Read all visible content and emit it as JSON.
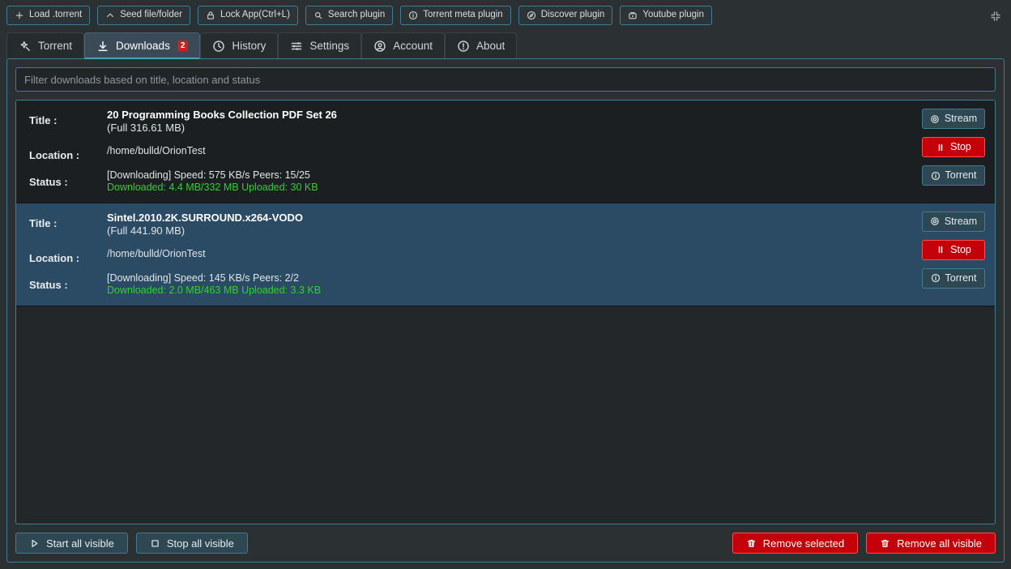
{
  "toolbar": {
    "buttons": [
      {
        "label": "Load .torrent",
        "icon": "plus-icon"
      },
      {
        "label": "Seed file/folder",
        "icon": "chevron-up-icon"
      },
      {
        "label": "Lock App(Ctrl+L)",
        "icon": "lock-icon"
      },
      {
        "label": "Search plugin",
        "icon": "search-icon"
      },
      {
        "label": "Torrent meta plugin",
        "icon": "info-circle-icon"
      },
      {
        "label": "Discover plugin",
        "icon": "compass-icon"
      },
      {
        "label": "Youtube plugin",
        "icon": "youtube-icon"
      }
    ],
    "collapse_icon": "collapse-icon"
  },
  "tabs": [
    {
      "label": "Torrent",
      "icon": "magic-wand-icon",
      "active": false,
      "badge": ""
    },
    {
      "label": "Downloads",
      "icon": "download-icon",
      "active": true,
      "badge": "2"
    },
    {
      "label": "History",
      "icon": "clock-icon",
      "active": false,
      "badge": ""
    },
    {
      "label": "Settings",
      "icon": "sliders-icon",
      "active": false,
      "badge": ""
    },
    {
      "label": "Account",
      "icon": "user-circle-icon",
      "active": false,
      "badge": ""
    },
    {
      "label": "About",
      "icon": "exclamation-circle-icon",
      "active": false,
      "badge": ""
    }
  ],
  "filter": {
    "placeholder": "Filter downloads based on title, location and status",
    "value": ""
  },
  "labels": {
    "title": "Title :",
    "location": "Location :",
    "status": "Status :"
  },
  "downloads": [
    {
      "title": "20 Programming Books Collection PDF Set 26",
      "size": "(Full 316.61 MB)",
      "location": "/home/bulld/OrionTest",
      "status_line1": "[Downloading] Speed: 575 KB/s Peers: 15/25",
      "status_line2": "Downloaded: 4.4 MB/332 MB Uploaded: 30 KB",
      "selected": false,
      "actions": [
        {
          "label": "Stream",
          "icon": "stream-icon",
          "style": "normal"
        },
        {
          "label": "Stop",
          "icon": "pause-icon",
          "style": "danger"
        },
        {
          "label": "Torrent",
          "icon": "info-circle-icon",
          "style": "normal"
        }
      ]
    },
    {
      "title": "Sintel.2010.2K.SURROUND.x264-VODO",
      "size": "(Full 441.90 MB)",
      "location": "/home/bulld/OrionTest",
      "status_line1": "[Downloading] Speed: 145 KB/s Peers: 2/2",
      "status_line2": "Downloaded: 2.0 MB/463 MB Uploaded: 3.3 KB",
      "selected": true,
      "actions": [
        {
          "label": "Stream",
          "icon": "stream-icon",
          "style": "normal"
        },
        {
          "label": "Stop",
          "icon": "pause-icon",
          "style": "danger"
        },
        {
          "label": "Torrent",
          "icon": "info-circle-icon",
          "style": "normal"
        }
      ]
    }
  ],
  "bottom_bar": {
    "left": [
      {
        "label": "Start all visible",
        "icon": "play-icon",
        "style": "normal"
      },
      {
        "label": "Stop all visible",
        "icon": "square-icon",
        "style": "normal"
      }
    ],
    "right": [
      {
        "label": "Remove selected",
        "icon": "trash-icon",
        "style": "danger"
      },
      {
        "label": "Remove all visible",
        "icon": "trash-icon",
        "style": "danger"
      }
    ]
  },
  "colors": {
    "accent": "#3f7d94",
    "tab_underline": "#4aa3bd",
    "badge": "#d01f1f",
    "danger": "#c4000a",
    "selected_row": "#2b4a63",
    "status_green": "#2fd22f",
    "window_bg": "#2b3033"
  }
}
